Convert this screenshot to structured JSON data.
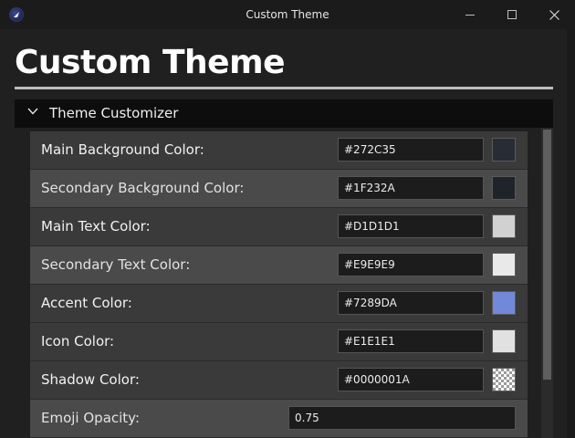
{
  "window": {
    "title": "Custom Theme",
    "icon": "app-logo-icon",
    "controls": [
      "minimize-icon",
      "maximize-icon",
      "close-icon"
    ]
  },
  "page": {
    "title": "Custom Theme"
  },
  "expander": {
    "label": "Theme Customizer",
    "expanded": true,
    "icon": "chevron-down-icon"
  },
  "colors": {
    "main_bg": "#272C35",
    "secondary_bg": "#1F232A",
    "main_text": "#D1D1D1",
    "secondary_text": "#E9E9E9",
    "accent": "#7289DA",
    "icon": "#E1E1E1",
    "shadow": "#0000001A"
  },
  "settings": [
    {
      "label": "Main Background Color:",
      "value": "#272C35",
      "swatch": "#272C35"
    },
    {
      "label": "Secondary Background Color:",
      "value": "#1F232A",
      "swatch": "#1F232A"
    },
    {
      "label": "Main Text Color:",
      "value": "#D1D1D1",
      "swatch": "#D1D1D1"
    },
    {
      "label": "Secondary Text Color:",
      "value": "#E9E9E9",
      "swatch": "#E9E9E9"
    },
    {
      "label": "Accent Color:",
      "value": "#7289DA",
      "swatch": "#7289DA"
    },
    {
      "label": "Icon Color:",
      "value": "#E1E1E1",
      "swatch": "#E1E1E1"
    },
    {
      "label": "Shadow Color:",
      "value": "#0000001A",
      "swatch": "#0000001A"
    }
  ],
  "emoji_opacity": {
    "label": "Emoji Opacity:",
    "value": "0.75"
  }
}
